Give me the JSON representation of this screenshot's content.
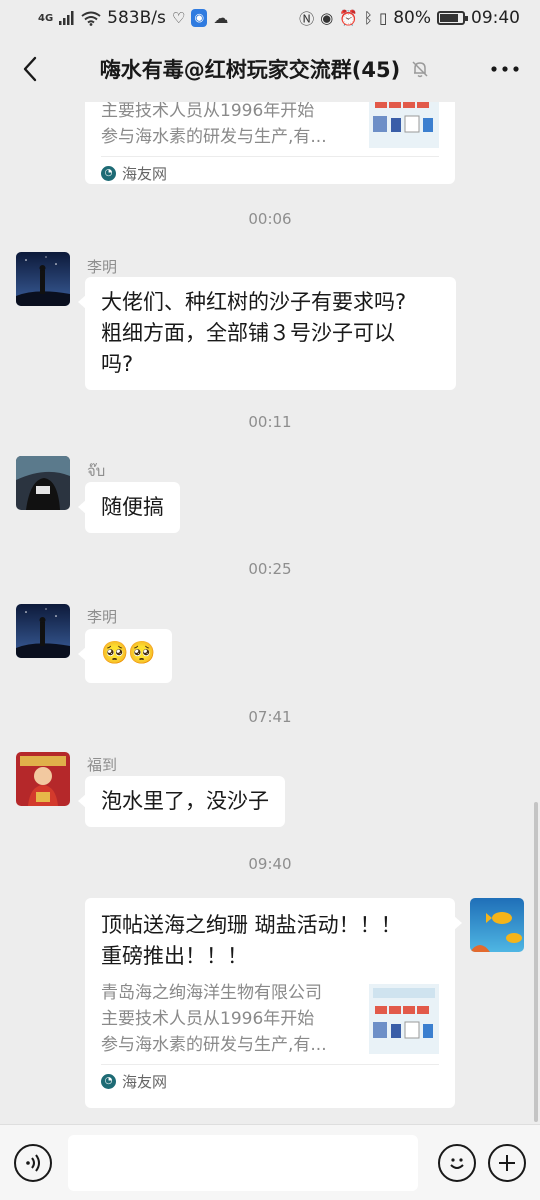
{
  "status_bar": {
    "network": "4G",
    "speed": "583B/s",
    "battery": "80%",
    "battery_level": 0.8,
    "time": "09:40"
  },
  "header": {
    "title": "嗨水有毒@红树玩家交流群(45)"
  },
  "messages": {
    "top_card": {
      "lines": [
        "主要技术人员从1996年开始",
        "参与海水素的研发与生产,有..."
      ],
      "source": "海友网"
    },
    "time1": "00:06",
    "msg1": {
      "sender": "李明",
      "text_line1": "大佬们、种红树的沙子有要求吗?",
      "text_line2": "粗细方面，全部铺３号沙子可以",
      "text_line3": "吗?"
    },
    "time2": "00:11",
    "msg2": {
      "sender": "จ๊บ",
      "text": "随便搞"
    },
    "time3": "00:25",
    "msg3": {
      "sender": "李明",
      "emoji": "🥺🥺"
    },
    "time4": "07:41",
    "msg4": {
      "sender": "福到",
      "text": "泡水里了，没沙子"
    },
    "time5": "09:40",
    "msg5": {
      "title_line1": "顶帖送海之绚珊 瑚盐活动！！！",
      "title_line2": "重磅推出！！！",
      "desc_lines": [
        "青岛海之绚海洋生物有限公司",
        "主要技术人员从1996年开始",
        "参与海水素的研发与生产,有..."
      ],
      "source": "海友网"
    }
  },
  "icons": {
    "back": "chevron-left-icon",
    "mute": "bell-off-icon",
    "more": "more-icon",
    "voice": "voice-icon",
    "emoji": "smiley-icon",
    "add": "plus-icon"
  },
  "colors": {
    "background": "#ededed",
    "bubble": "#ffffff",
    "secondary_text": "#8e8e8e"
  }
}
